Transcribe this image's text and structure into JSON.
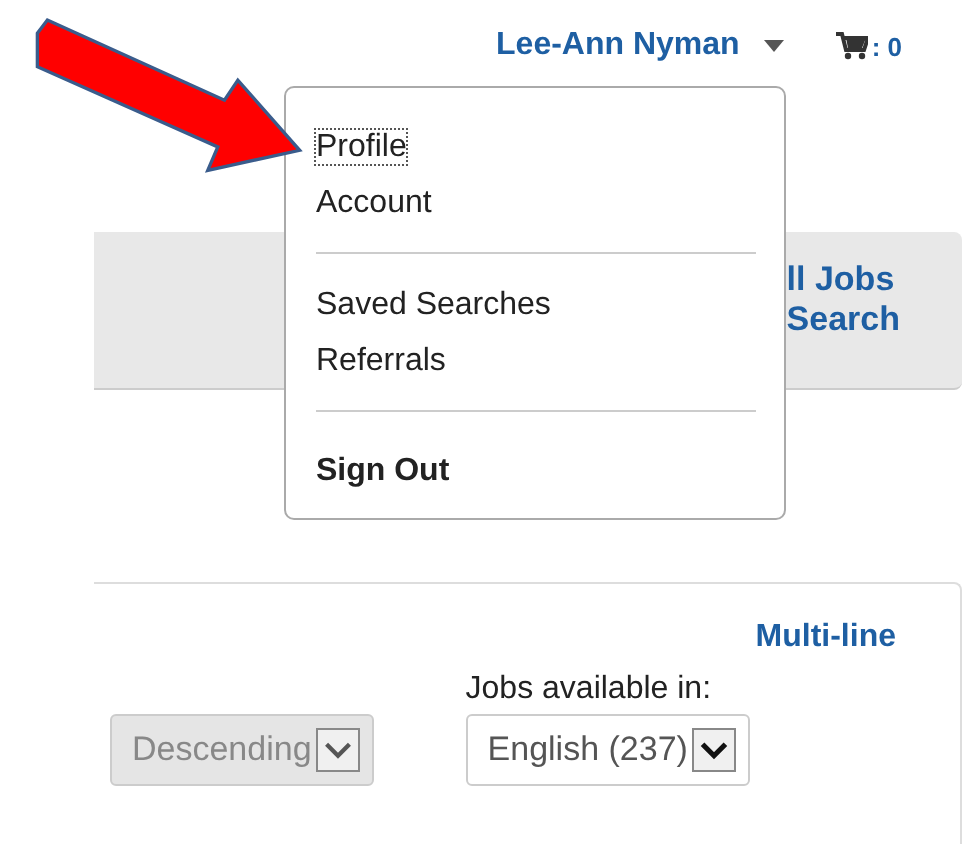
{
  "header": {
    "user_name": "Lee-Ann Nyman",
    "user_menu_expanded": true,
    "cart_count": ": 0"
  },
  "user_menu": {
    "items": [
      {
        "kind": "item",
        "label": "Profile",
        "focused": true
      },
      {
        "kind": "item",
        "label": "Account",
        "focused": false
      },
      {
        "kind": "divider"
      },
      {
        "kind": "item",
        "label": "Saved Searches",
        "focused": false
      },
      {
        "kind": "item",
        "label": "Referrals",
        "focused": false
      },
      {
        "kind": "divider"
      },
      {
        "kind": "strong",
        "label": "Sign Out",
        "focused": false
      }
    ]
  },
  "search_panel": {
    "links": [
      "ll Jobs",
      "Search"
    ]
  },
  "results_panel": {
    "view_link": "Multi-line",
    "sort_order": {
      "value": "Descending",
      "disabled": true
    },
    "language": {
      "label": "Jobs available in:",
      "value": "English (237)",
      "disabled": false
    }
  }
}
